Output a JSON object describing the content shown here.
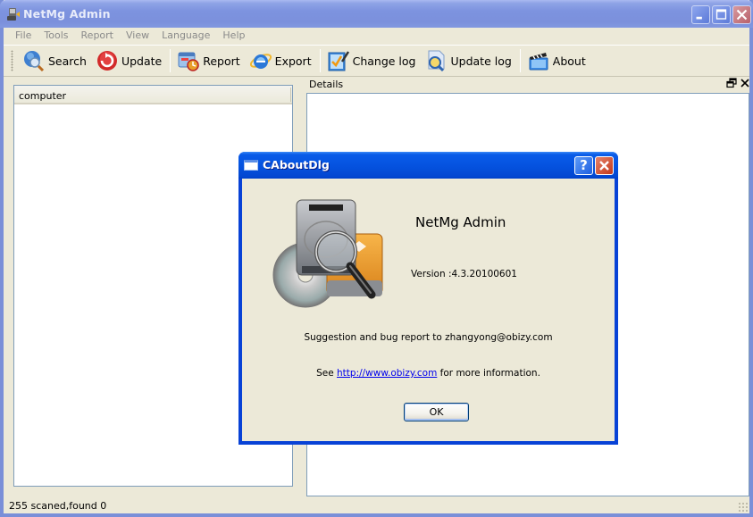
{
  "window": {
    "title": "NetMg Admin",
    "icons": {
      "app": "app-computer-icon",
      "minimize": "minimize-icon",
      "maximize": "maximize-icon",
      "close": "close-icon"
    }
  },
  "menubar": {
    "items": [
      "File",
      "Tools",
      "Report",
      "View",
      "Language",
      "Help"
    ]
  },
  "toolbar": {
    "buttons": [
      {
        "label": "Search",
        "icon": "globe-search-icon"
      },
      {
        "label": "Update",
        "icon": "refresh-icon"
      },
      {
        "label": "Report",
        "icon": "report-icon"
      },
      {
        "label": "Export",
        "icon": "internet-explorer-icon"
      },
      {
        "label": "Change log",
        "icon": "checklist-pencil-icon"
      },
      {
        "label": "Update log",
        "icon": "document-magnifier-icon"
      },
      {
        "label": "About",
        "icon": "clapperboard-icon"
      }
    ]
  },
  "left_panel": {
    "column_header": "computer",
    "rows": []
  },
  "details_panel": {
    "title": "Details",
    "restore_glyph": "🗗",
    "close_glyph": "✕"
  },
  "statusbar": {
    "text": "255 scaned,found 0"
  },
  "about_dialog": {
    "title": "CAboutDlg",
    "help_glyph": "?",
    "close_glyph": "✕",
    "app_name": "NetMg Admin",
    "version": "Version :4.3.20100601",
    "suggestion": "Suggestion and bug report to zhangyong@obizy.com",
    "see_prefix": "See ",
    "link": "http://www.obizy.com",
    "see_suffix": " for more information.",
    "ok_label": "OK",
    "graphic": "disk-utility-magnifier-icon"
  },
  "colors": {
    "dialog_title_blue": "#0553e0",
    "inactive_title_blue": "#7d93df",
    "window_face": "#ece9d8",
    "link_blue": "#0000ee"
  }
}
